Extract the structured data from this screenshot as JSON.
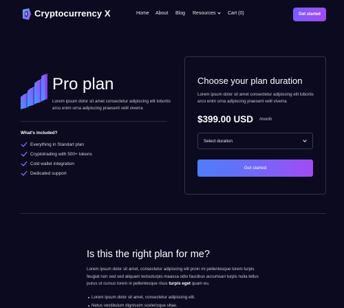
{
  "nav": {
    "brand": "Cryptocurrency X",
    "links": [
      "Home",
      "About",
      "Blog",
      "Resources",
      "Cart (0)"
    ],
    "cta": "Get started"
  },
  "plan": {
    "title": "Pro plan",
    "description": "Lorem ipsum dolor sit amet consectetur adipiscing elit lobortis arcu enim urna adipiscing praesent velit viverra",
    "included_title": "What's included?",
    "features": [
      "Everything in Standart plan",
      "Cryptotrading with 500+ tokens",
      "Cold wallet integration",
      "Dedicated support"
    ]
  },
  "card": {
    "title": "Choose your plan duration",
    "description": "Lorem ipsum dolor sit amet consectetur adipiscing elit lobortis arcu enim urna adipiscing praesent velit viverra.",
    "price": "$399.00 USD",
    "period": "/month",
    "select_placeholder": "Select duration",
    "cta": "Get started"
  },
  "faq": {
    "title": "Is this the right plan for me?",
    "para_before": "Lorem ipsum dolor sit amet, consectetur adipiscing elit proin mi pellentesque lorem turpis feugiat non sed sed aliquam lectusturpis maassa odio faucibus accumsan turpis nulla tellus purus ut cursus lorem in pellentesque risus",
    "para_bold": "turpis eget",
    "para_after": " quam eu.",
    "bullets": [
      "Lorem ipsum dolor sit amet, consectetur adipiscing elit.",
      "Netus vestibulum dignissim scelerisque vitae."
    ]
  },
  "colors": {
    "background": "#0b0a1e",
    "accent_gradient_start": "#4e7dfb",
    "accent_gradient_end": "#a24bf3",
    "check": "#8b6bff"
  },
  "icons": [
    "logo-icon",
    "stairs-icon",
    "chevron-down-icon",
    "check-icon"
  ]
}
